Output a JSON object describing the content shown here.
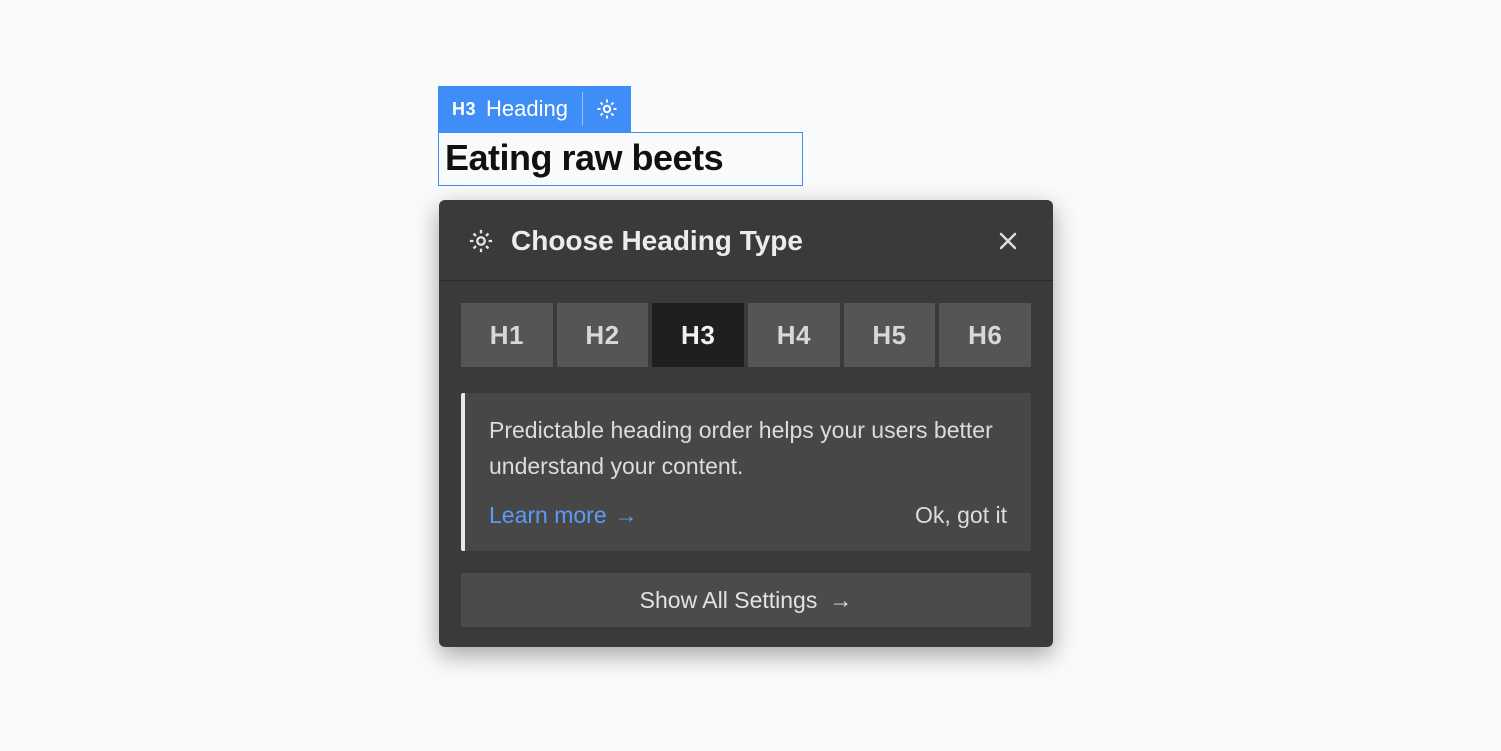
{
  "block": {
    "tag_icon_label": "H3",
    "tag_text": "Heading",
    "heading_value": "Eating raw beets"
  },
  "popover": {
    "title": "Choose Heading Type",
    "options": [
      "H1",
      "H2",
      "H3",
      "H4",
      "H5",
      "H6"
    ],
    "active_index": 2,
    "info_text": "Predictable heading order helps your users better understand your content.",
    "learn_more_label": "Learn more",
    "ok_label": "Ok, got it",
    "show_all_label": "Show All Settings"
  }
}
